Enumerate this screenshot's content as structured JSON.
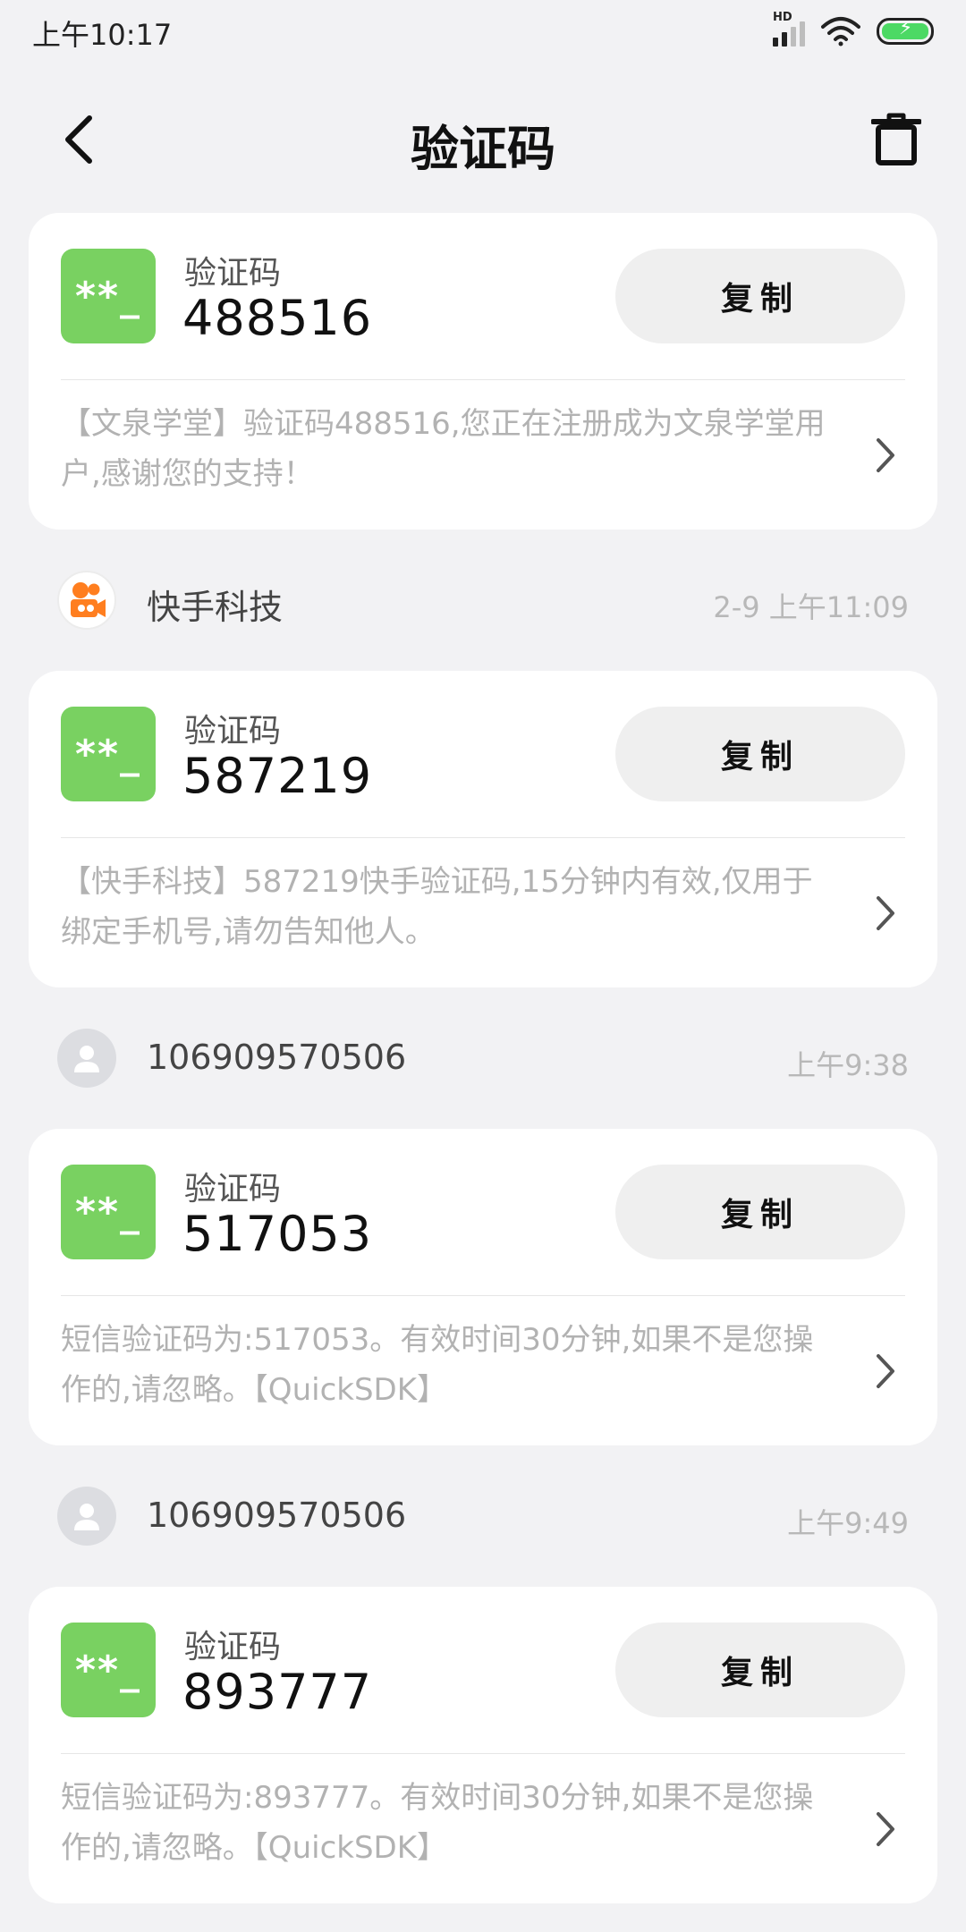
{
  "status_bar": {
    "time": "上午10:17",
    "network_badge": "HD",
    "signal_icon": "signal-icon",
    "wifi_icon": "wifi-icon",
    "battery_icon": "battery-charging-icon"
  },
  "header": {
    "title": "验证码",
    "back_icon": "back-icon",
    "delete_icon": "trash-icon"
  },
  "colors": {
    "code_icon_green": "#79d161",
    "page_bg": "#f2f2f4",
    "card_bg": "#ffffff",
    "copy_btn_bg": "#efefef",
    "body_text": "#b2b2b2",
    "time_text": "#b8b8b8"
  },
  "messages": [
    {
      "sender": "",
      "time": "",
      "avatar": "none",
      "code_icon_text": "**_",
      "code_label": "验证码",
      "code": "488516",
      "copy_label": "复制",
      "body": "【文泉学堂】验证码488516,您正在注册成为文泉学堂用户,感谢您的支持！"
    },
    {
      "sender": "快手科技",
      "time": "2-9 上午11:09",
      "avatar": "kuaishou-logo-icon",
      "code_icon_text": "**_",
      "code_label": "验证码",
      "code": "587219",
      "copy_label": "复制",
      "body": "【快手科技】587219快手验证码,15分钟内有效,仅用于绑定手机号,请勿告知他人。"
    },
    {
      "sender": "106909570506",
      "time": "上午9:38",
      "avatar": "user-avatar-icon",
      "code_icon_text": "**_",
      "code_label": "验证码",
      "code": "517053",
      "copy_label": "复制",
      "body": "短信验证码为:517053。有效时间30分钟,如果不是您操作的,请忽略。【QuickSDK】"
    },
    {
      "sender": "106909570506",
      "time": "上午9:49",
      "avatar": "user-avatar-icon",
      "code_icon_text": "**_",
      "code_label": "验证码",
      "code": "893777",
      "copy_label": "复制",
      "body": "短信验证码为:893777。有效时间30分钟,如果不是您操作的,请忽略。【QuickSDK】"
    }
  ]
}
